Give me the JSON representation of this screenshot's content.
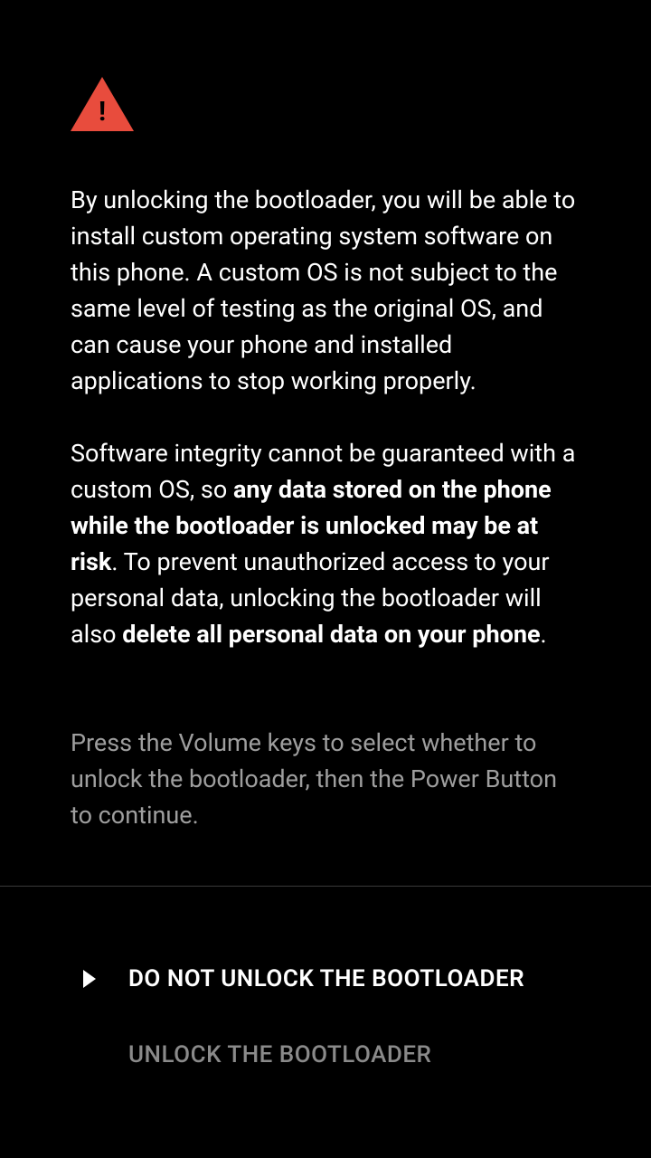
{
  "warning": {
    "icon": "warning-triangle",
    "p1": "By unlocking the bootloader, you will be able to install custom operating system software on this phone. A custom OS is not subject to the same level of testing as the original OS, and can cause your phone and installed applications to stop working properly.",
    "p2_a": "Software integrity cannot be guaranteed with a custom OS, so ",
    "p2_b": "any data stored on the phone while the bootloader is unlocked may be at risk",
    "p2_c": ". To prevent unauthorized access to your personal data, unlocking the bootloader will also ",
    "p2_d": "delete all personal data on your phone",
    "p2_e": "."
  },
  "hint": "Press the Volume keys to select whether to unlock the bootloader, then the Power Button to continue.",
  "options": {
    "do_not_unlock": "DO NOT UNLOCK THE BOOTLOADER",
    "unlock": "UNLOCK THE BOOTLOADER"
  }
}
